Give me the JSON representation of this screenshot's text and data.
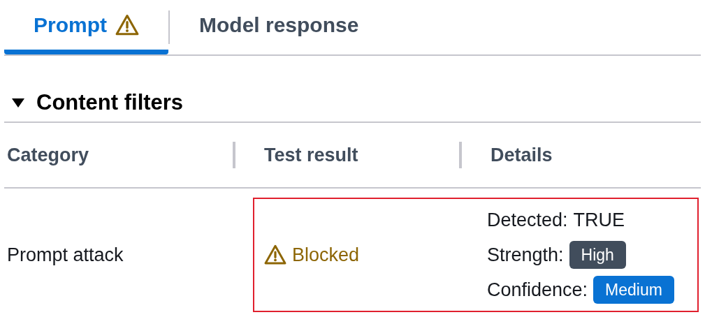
{
  "tabs": [
    {
      "label": "Prompt",
      "selected": true,
      "warning": true
    },
    {
      "label": "Model response",
      "selected": false,
      "warning": false
    }
  ],
  "section": {
    "title": "Content filters",
    "expanded": true
  },
  "table": {
    "columns": [
      "Category",
      "Test result",
      "Details"
    ],
    "rows": [
      {
        "category": "Prompt attack",
        "result": "Blocked",
        "blocked": true,
        "highlighted": true,
        "details": [
          {
            "label": "Detected:",
            "value": "TRUE",
            "kind": "text"
          },
          {
            "label": "Strength:",
            "value": "High",
            "kind": "badge",
            "color": "#414d5c"
          },
          {
            "label": "Confidence:",
            "value": "Medium",
            "kind": "badge",
            "color": "#0972d3"
          }
        ]
      }
    ]
  }
}
